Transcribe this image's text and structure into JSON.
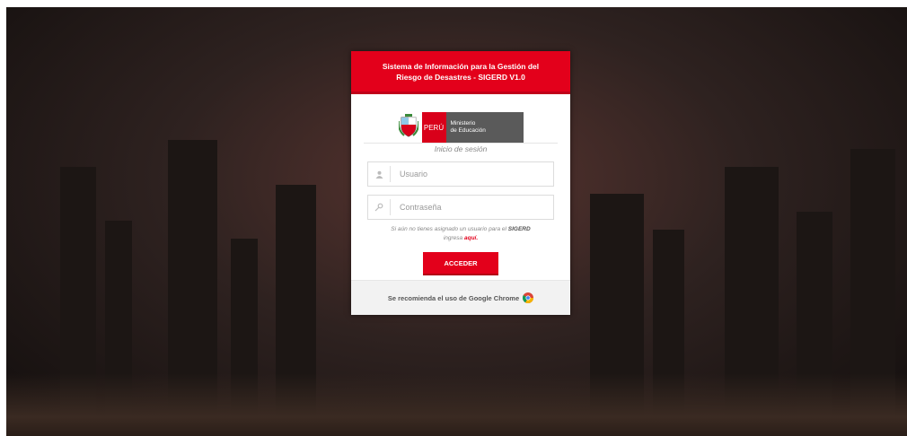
{
  "header": {
    "title_line1": "Sistema de Información para la Gestión del",
    "title_line2": "Riesgo de Desastres - SIGERD V1.0"
  },
  "logo": {
    "peru": "PERÚ",
    "ministry_line1": "Ministerio",
    "ministry_line2": "de Educación"
  },
  "login": {
    "title": "Inicio de sesión",
    "username_placeholder": "Usuario",
    "password_placeholder": "Contraseña",
    "hint_prefix": "Si aún no tienes asignado un usuario para el",
    "hint_system": "SIGERD",
    "hint_mid": "ingresa",
    "hint_link": "aquí.",
    "submit_label": "ACCEDER"
  },
  "footer": {
    "text": "Se recomienda el uso de Google Chrome"
  },
  "icons": {
    "user": "user-icon",
    "key": "key-icon",
    "chrome": "chrome-logo-icon",
    "coat_of_arms": "coat-of-arms-icon"
  },
  "colors": {
    "brand_red": "#e3001b",
    "ministry_gray": "#5a5a5a"
  }
}
